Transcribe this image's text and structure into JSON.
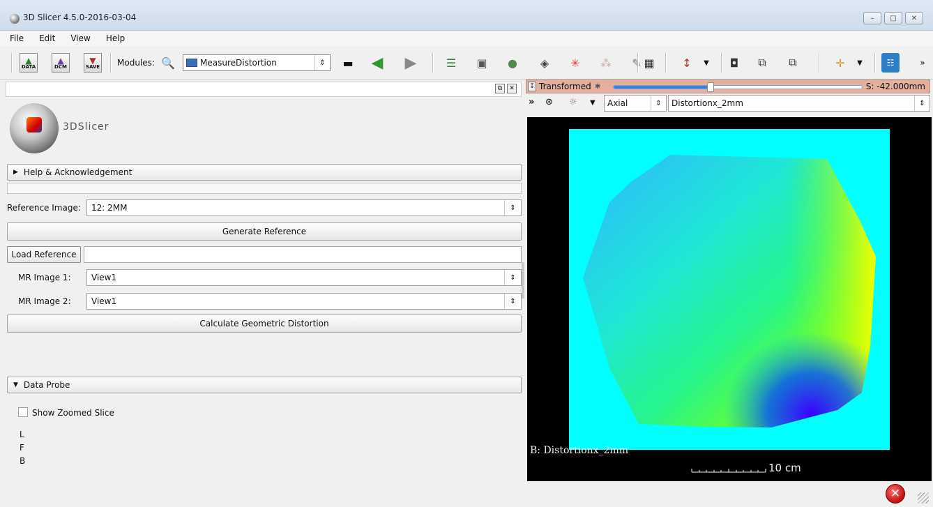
{
  "window": {
    "title": "3D Slicer 4.5.0-2016-03-04",
    "controls": [
      "–",
      "□",
      "✕"
    ]
  },
  "menu": [
    "File",
    "Edit",
    "View",
    "Help"
  ],
  "toolbar": {
    "data_label": "DATA",
    "dcm_label": "DCM",
    "save_label": "SAVE",
    "modules_label": "Modules:",
    "module_selected": "MeasureDistortion",
    "more": "»"
  },
  "left_panel": {
    "logo_text": "3DSlicer",
    "help_section": "Help & Acknowledgement",
    "reference_image_label": "Reference Image:",
    "reference_image_value": "12: 2MM",
    "generate_reference": "Generate Reference",
    "load_reference": "Load Reference",
    "load_reference_path": "",
    "mr1_label": "MR Image 1:",
    "mr1_value": "View1",
    "mr2_label": "MR Image 2:",
    "mr2_value": "View1",
    "calculate": "Calculate Geometric  Distortion",
    "data_probe_section": "Data Probe",
    "show_zoomed_slice": "Show Zoomed Slice",
    "probe_lines": [
      "L",
      "F",
      "B"
    ]
  },
  "slice_view": {
    "layer_label": "Transformed",
    "slice_offset_fraction": 0.39,
    "slice_value": "S: -42.000mm",
    "more": "»",
    "orientation": "Axial",
    "volume": "Distortionx_2mm",
    "overlay_label": "B: Distortionx_2mm",
    "scale_text": "10 cm"
  },
  "colors": {
    "slice_bar": "#e3b09e",
    "viewer_background": "#000000",
    "volume_fill": "#00ffff"
  }
}
